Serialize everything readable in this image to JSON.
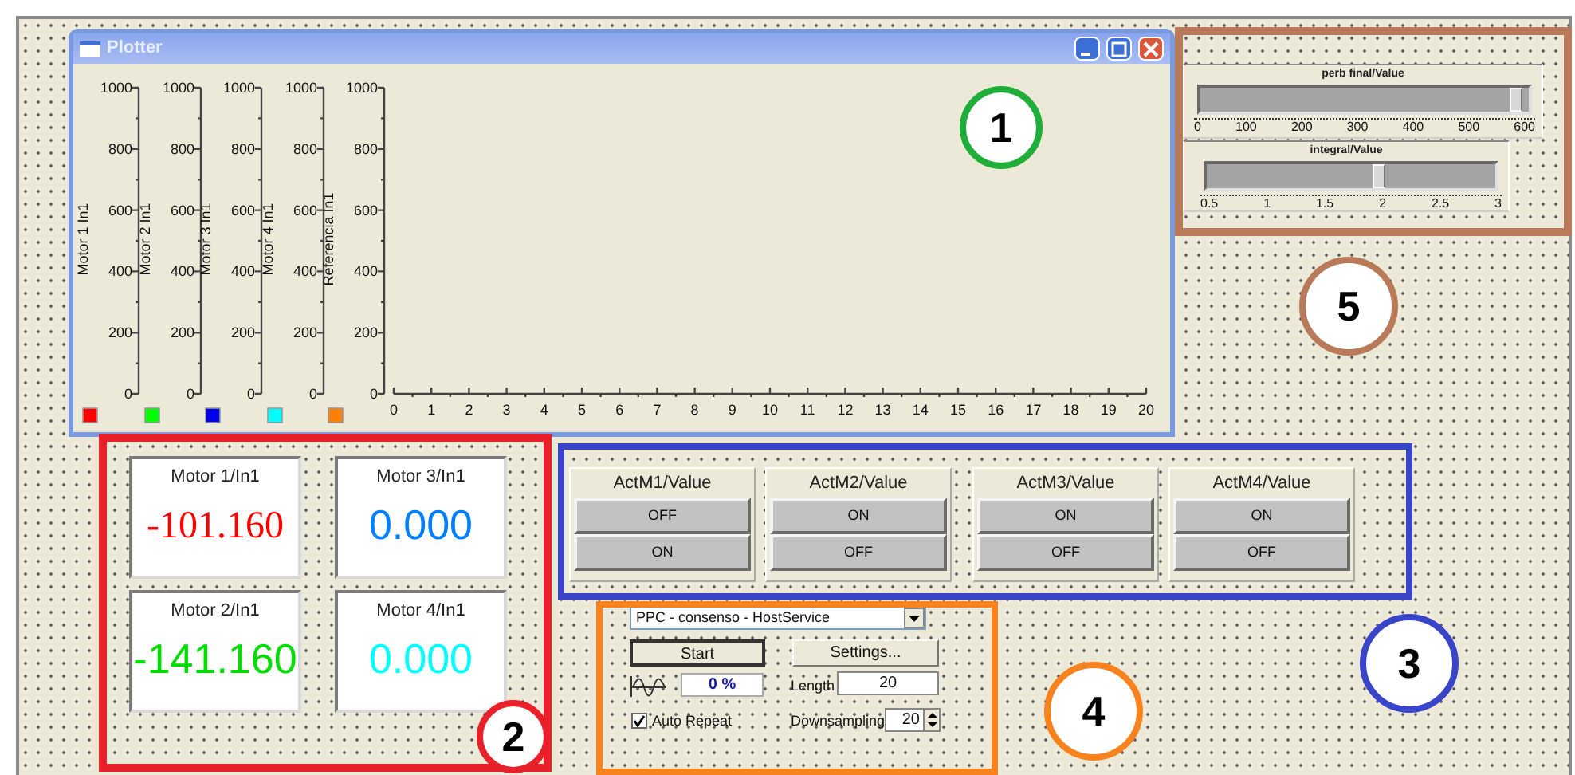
{
  "plotter": {
    "title": "Plotter",
    "y_axes": [
      {
        "label": "Motor 1 In1",
        "color": "#ff0000",
        "ticks": [
          "1000",
          "800",
          "600",
          "400",
          "200",
          "0"
        ]
      },
      {
        "label": "Motor 2 In1",
        "color": "#00ff00",
        "ticks": [
          "1000",
          "800",
          "600",
          "400",
          "200",
          "0"
        ]
      },
      {
        "label": "Motor 3 In1",
        "color": "#0000ee",
        "ticks": [
          "1000",
          "800",
          "600",
          "400",
          "200",
          "0"
        ]
      },
      {
        "label": "Motor 4 In1",
        "color": "#00ffff",
        "ticks": [
          "1000",
          "800",
          "600",
          "400",
          "200",
          "0"
        ]
      },
      {
        "label": "Referencia In1",
        "color": "#ff7f00",
        "ticks": [
          "1000",
          "800",
          "600",
          "400",
          "200",
          "0"
        ]
      }
    ],
    "x_ticks": [
      "0",
      "1",
      "2",
      "3",
      "4",
      "5",
      "6",
      "7",
      "8",
      "9",
      "10",
      "11",
      "12",
      "13",
      "14",
      "15",
      "16",
      "17",
      "18",
      "19",
      "20"
    ]
  },
  "displays": [
    {
      "label": "Motor 1/In1",
      "value": "-101.160",
      "color": "#ff0000",
      "kind": "serif"
    },
    {
      "label": "Motor 3/In1",
      "value": "0.000",
      "color": "#0080ff",
      "kind": "sans"
    },
    {
      "label": "Motor 2/In1",
      "value": "-141.160",
      "color": "#00dd00",
      "kind": "sans"
    },
    {
      "label": "Motor 4/In1",
      "value": "0.000",
      "color": "#00ffff",
      "kind": "sans"
    }
  ],
  "switches": [
    {
      "label": "ActM1/Value",
      "buttons": [
        "OFF",
        "ON"
      ]
    },
    {
      "label": "ActM2/Value",
      "buttons": [
        "ON",
        "OFF"
      ]
    },
    {
      "label": "ActM3/Value",
      "buttons": [
        "ON",
        "OFF"
      ]
    },
    {
      "label": "ActM4/Value",
      "buttons": [
        "ON",
        "OFF"
      ]
    }
  ],
  "host": {
    "service": "PPC - consenso - HostService",
    "start": "Start",
    "settings": "Settings...",
    "progress": "0 %",
    "length_label": "Length",
    "length": "20",
    "auto_repeat": {
      "label": "Auto Repeat",
      "checked": true
    },
    "downsampling_label": "Downsampling",
    "downsampling": "20"
  },
  "sliders": [
    {
      "label": "perb final/Value",
      "level": 0.98,
      "ticks": [
        "0",
        "100",
        "200",
        "300",
        "400",
        "500",
        "600"
      ]
    },
    {
      "label": "integral/Value",
      "level": 0.6,
      "ticks": [
        "0.5",
        "1",
        "1.5",
        "2",
        "2.5",
        "3"
      ]
    }
  ],
  "annotations": [
    {
      "number": "1",
      "color": "#1fae3a"
    },
    {
      "number": "2",
      "color": "#e8202a"
    },
    {
      "number": "3",
      "color": "#3a44c8"
    },
    {
      "number": "4",
      "color": "#f7821e"
    },
    {
      "number": "5",
      "color": "#b87a58"
    }
  ]
}
